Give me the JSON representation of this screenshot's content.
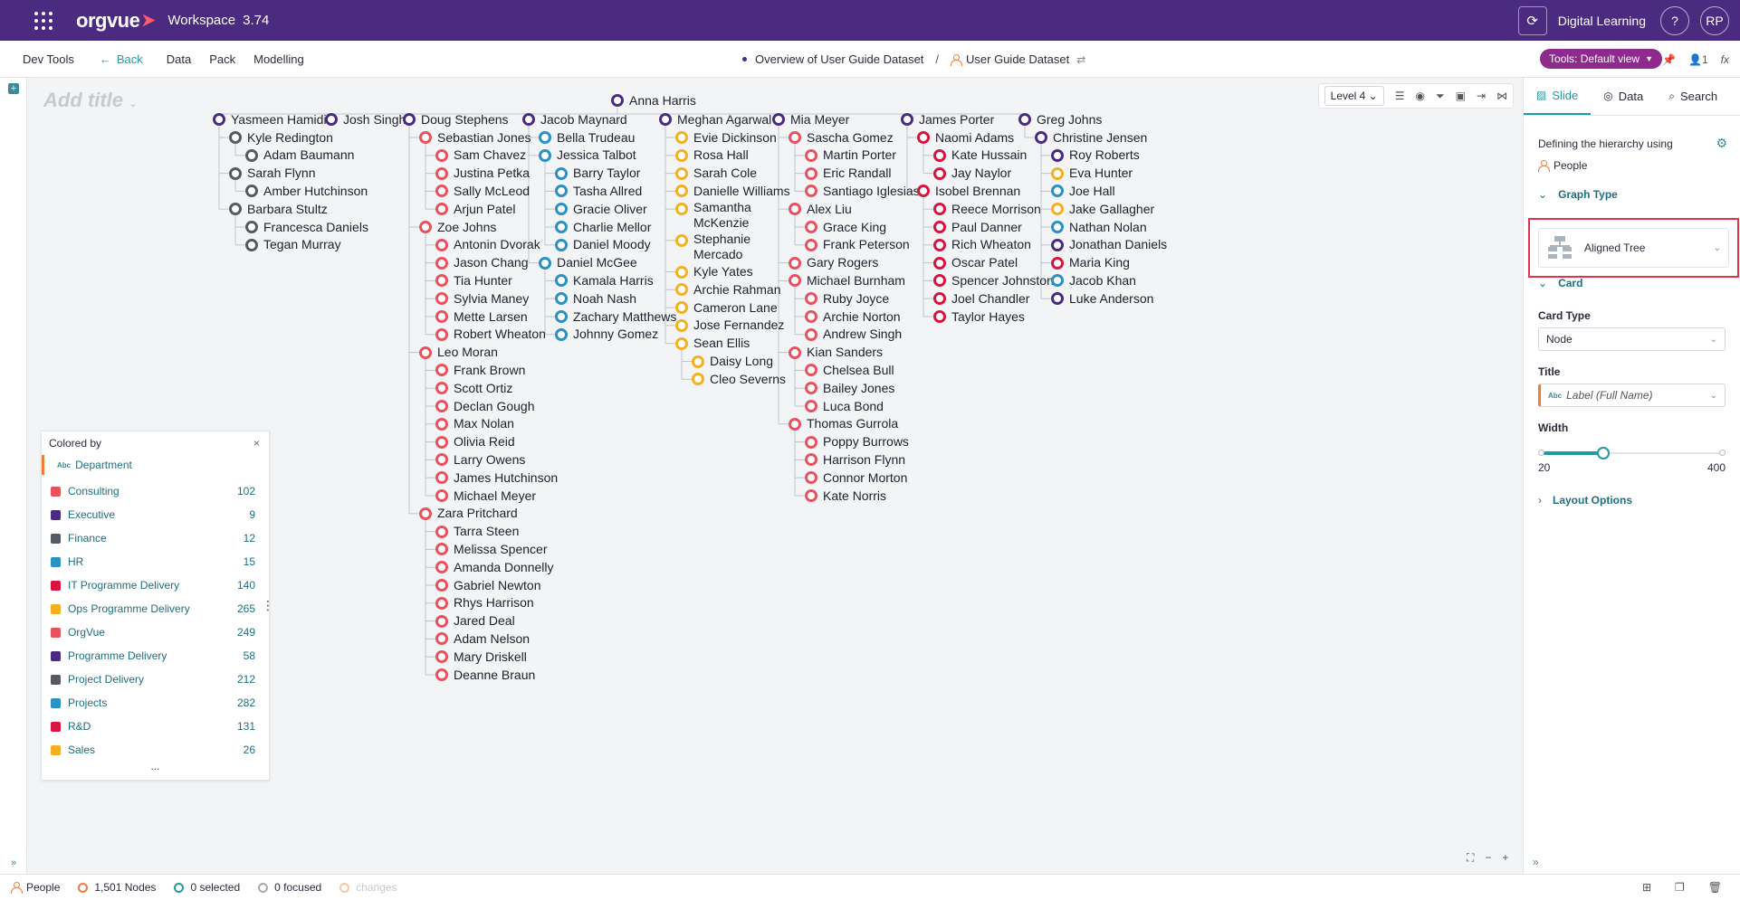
{
  "topbar": {
    "logo": "orgvue",
    "workspace": "Workspace",
    "version": "3.74",
    "digital_learning": "Digital Learning",
    "help": "?",
    "avatar": "RP"
  },
  "navbar": {
    "dev_tools": "Dev Tools",
    "back": "Back",
    "data": "Data",
    "pack": "Pack",
    "modelling": "Modelling",
    "breadcrumb_1": "Overview of User Guide Dataset",
    "breadcrumb_sep": "/",
    "breadcrumb_2": "User Guide Dataset",
    "tools": "Tools: Default view",
    "counter": "1"
  },
  "canvas": {
    "add_title": "Add title",
    "level": "Level 4"
  },
  "colors": {
    "Consulting": "#e8525e",
    "Executive": "#4a2b7f",
    "Finance": "#555a63",
    "HR": "#2b90c2",
    "IT Programme Delivery": "#d9143e",
    "Ops Programme Delivery": "#f5b021",
    "OrgVue": "#e8525e",
    "Programme Delivery": "#4a2b7f",
    "Project Delivery": "#555a63",
    "Projects": "#2b90c2",
    "R&D": "#d9143e",
    "Sales": "#f5b021"
  },
  "tree": {
    "root": "Anna Harris",
    "columns": [
      {
        "name": "Yasmeen Hamidi",
        "color": "#4a2b7f",
        "children": [
          {
            "name": "Kyle Redington",
            "color": "#555a63",
            "children": [
              {
                "name": "Adam Baumann",
                "color": "#555a63"
              }
            ]
          },
          {
            "name": "Sarah Flynn",
            "color": "#555a63",
            "children": [
              {
                "name": "Amber Hutchinson",
                "color": "#555a63"
              }
            ]
          },
          {
            "name": "Barbara Stultz",
            "color": "#555a63",
            "children": [
              {
                "name": "Francesca Daniels",
                "color": "#555a63"
              },
              {
                "name": "Tegan Murray",
                "color": "#555a63"
              }
            ]
          }
        ]
      },
      {
        "name": "Josh Singh",
        "color": "#4a2b7f",
        "children": []
      },
      {
        "name": "Doug Stephens",
        "color": "#4a2b7f",
        "children": [
          {
            "name": "Sebastian Jones",
            "color": "#e8525e",
            "children": [
              {
                "name": "Sam Chavez",
                "color": "#e8525e"
              },
              {
                "name": "Justina Petka",
                "color": "#e8525e"
              },
              {
                "name": "Sally McLeod",
                "color": "#e8525e"
              },
              {
                "name": "Arjun Patel",
                "color": "#e8525e"
              }
            ]
          },
          {
            "name": "Zoe Johns",
            "color": "#e8525e",
            "children": [
              {
                "name": "Antonin Dvorak",
                "color": "#e8525e"
              },
              {
                "name": "Jason Chang",
                "color": "#e8525e"
              },
              {
                "name": "Tia Hunter",
                "color": "#e8525e"
              },
              {
                "name": "Sylvia Maney",
                "color": "#e8525e"
              },
              {
                "name": "Mette Larsen",
                "color": "#e8525e"
              },
              {
                "name": "Robert Wheaton",
                "color": "#e8525e"
              }
            ]
          },
          {
            "name": "Leo Moran",
            "color": "#e8525e",
            "children": [
              {
                "name": "Frank Brown",
                "color": "#e8525e"
              },
              {
                "name": "Scott Ortiz",
                "color": "#e8525e"
              },
              {
                "name": "Declan Gough",
                "color": "#e8525e"
              },
              {
                "name": "Max Nolan",
                "color": "#e8525e"
              },
              {
                "name": "Olivia Reid",
                "color": "#e8525e"
              },
              {
                "name": "Larry Owens",
                "color": "#e8525e"
              },
              {
                "name": "James Hutchinson",
                "color": "#e8525e"
              },
              {
                "name": "Michael Meyer",
                "color": "#e8525e"
              }
            ]
          },
          {
            "name": "Zara Pritchard",
            "color": "#e8525e",
            "children": [
              {
                "name": "Tarra Steen",
                "color": "#e8525e"
              },
              {
                "name": "Melissa Spencer",
                "color": "#e8525e"
              },
              {
                "name": "Amanda Donnelly",
                "color": "#e8525e"
              },
              {
                "name": "Gabriel Newton",
                "color": "#e8525e"
              },
              {
                "name": "Rhys Harrison",
                "color": "#e8525e"
              },
              {
                "name": "Jared Deal",
                "color": "#e8525e"
              },
              {
                "name": "Adam Nelson",
                "color": "#e8525e"
              },
              {
                "name": "Mary Driskell",
                "color": "#e8525e"
              },
              {
                "name": "Deanne Braun",
                "color": "#e8525e"
              }
            ]
          }
        ]
      },
      {
        "name": "Jacob Maynard",
        "color": "#4a2b7f",
        "children": [
          {
            "name": "Bella Trudeau",
            "color": "#2b90c2",
            "children": []
          },
          {
            "name": "Jessica Talbot",
            "color": "#2b90c2",
            "children": [
              {
                "name": "Barry Taylor",
                "color": "#2b90c2"
              },
              {
                "name": "Tasha Allred",
                "color": "#2b90c2"
              },
              {
                "name": "Gracie Oliver",
                "color": "#2b90c2"
              },
              {
                "name": "Charlie Mellor",
                "color": "#2b90c2"
              },
              {
                "name": "Daniel Moody",
                "color": "#2b90c2"
              }
            ]
          },
          {
            "name": "Daniel McGee",
            "color": "#2b90c2",
            "children": [
              {
                "name": "Kamala Harris",
                "color": "#2b90c2"
              },
              {
                "name": "Noah Nash",
                "color": "#2b90c2"
              },
              {
                "name": "Zachary Matthews",
                "color": "#2b90c2"
              },
              {
                "name": "Johnny Gomez",
                "color": "#2b90c2"
              }
            ]
          }
        ]
      },
      {
        "name": "Meghan Agarwal",
        "color": "#4a2b7f",
        "children": [
          {
            "name": "Evie Dickinson",
            "color": "#f5b021",
            "children": []
          },
          {
            "name": "Rosa Hall",
            "color": "#f5b021",
            "children": []
          },
          {
            "name": "Sarah Cole",
            "color": "#f5b021",
            "children": []
          },
          {
            "name": "Danielle Williams",
            "color": "#f5b021",
            "children": []
          },
          {
            "name": "Samantha McKenzie",
            "color": "#f5b021",
            "children": []
          },
          {
            "name": "Stephanie Mercado",
            "color": "#f5b021",
            "children": []
          },
          {
            "name": "Kyle Yates",
            "color": "#f5b021",
            "children": []
          },
          {
            "name": "Archie Rahman",
            "color": "#f5b021",
            "children": []
          },
          {
            "name": "Cameron Lane",
            "color": "#f5b021",
            "children": []
          },
          {
            "name": "Jose Fernandez",
            "color": "#f5b021",
            "children": []
          },
          {
            "name": "Sean Ellis",
            "color": "#f5b021",
            "children": [
              {
                "name": "Daisy Long",
                "color": "#f5b021"
              },
              {
                "name": "Cleo Severns",
                "color": "#f5b021"
              }
            ]
          }
        ]
      },
      {
        "name": "Mia Meyer",
        "color": "#4a2b7f",
        "children": [
          {
            "name": "Sascha Gomez",
            "color": "#e8525e",
            "children": [
              {
                "name": "Martin Porter",
                "color": "#e8525e"
              },
              {
                "name": "Eric Randall",
                "color": "#e8525e"
              },
              {
                "name": "Santiago Iglesias",
                "color": "#e8525e"
              }
            ]
          },
          {
            "name": "Alex Liu",
            "color": "#e8525e",
            "children": [
              {
                "name": "Grace King",
                "color": "#e8525e"
              },
              {
                "name": "Frank Peterson",
                "color": "#e8525e"
              }
            ]
          },
          {
            "name": "Gary Rogers",
            "color": "#e8525e",
            "children": []
          },
          {
            "name": "Michael Burnham",
            "color": "#e8525e",
            "children": [
              {
                "name": "Ruby Joyce",
                "color": "#e8525e"
              },
              {
                "name": "Archie Norton",
                "color": "#e8525e"
              },
              {
                "name": "Andrew Singh",
                "color": "#e8525e"
              }
            ]
          },
          {
            "name": "Kian Sanders",
            "color": "#e8525e",
            "children": [
              {
                "name": "Chelsea Bull",
                "color": "#e8525e"
              },
              {
                "name": "Bailey Jones",
                "color": "#e8525e"
              },
              {
                "name": "Luca Bond",
                "color": "#e8525e"
              }
            ]
          },
          {
            "name": "Thomas Gurrola",
            "color": "#e8525e",
            "children": [
              {
                "name": "Poppy Burrows",
                "color": "#e8525e"
              },
              {
                "name": "Harrison Flynn",
                "color": "#e8525e"
              },
              {
                "name": "Connor Morton",
                "color": "#e8525e"
              },
              {
                "name": "Kate Norris",
                "color": "#e8525e"
              }
            ]
          }
        ]
      },
      {
        "name": "James Porter",
        "color": "#4a2b7f",
        "children": [
          {
            "name": "Naomi Adams",
            "color": "#d9143e",
            "children": [
              {
                "name": "Kate Hussain",
                "color": "#d9143e"
              },
              {
                "name": "Jay Naylor",
                "color": "#d9143e"
              }
            ]
          },
          {
            "name": "Isobel Brennan",
            "color": "#d9143e",
            "children": [
              {
                "name": "Reece Morrison",
                "color": "#d9143e"
              },
              {
                "name": "Paul Danner",
                "color": "#d9143e"
              },
              {
                "name": "Rich Wheaton",
                "color": "#d9143e"
              },
              {
                "name": "Oscar Patel",
                "color": "#d9143e"
              },
              {
                "name": "Spencer Johnston",
                "color": "#d9143e"
              },
              {
                "name": "Joel Chandler",
                "color": "#d9143e"
              },
              {
                "name": "Taylor Hayes",
                "color": "#d9143e"
              }
            ]
          }
        ]
      },
      {
        "name": "Greg Johns",
        "color": "#4a2b7f",
        "children": [
          {
            "name": "Christine Jensen",
            "color": "#4a2b7f",
            "children": [
              {
                "name": "Roy Roberts",
                "color": "#4a2b7f"
              },
              {
                "name": "Eva Hunter",
                "color": "#f5b021"
              },
              {
                "name": "Joe Hall",
                "color": "#2b90c2"
              },
              {
                "name": "Jake Gallagher",
                "color": "#f5b021"
              },
              {
                "name": "Nathan Nolan",
                "color": "#2b90c2"
              },
              {
                "name": "Jonathan Daniels",
                "color": "#4a2b7f"
              },
              {
                "name": "Maria King",
                "color": "#d9143e"
              },
              {
                "name": "Jacob Khan",
                "color": "#2b90c2"
              },
              {
                "name": "Luke Anderson",
                "color": "#4a2b7f"
              }
            ]
          }
        ]
      }
    ]
  },
  "legend": {
    "header": "Colored by",
    "close": "×",
    "field": "Department",
    "more": "...",
    "items": [
      {
        "name": "Consulting",
        "count": "102",
        "color": "#e8525e"
      },
      {
        "name": "Executive",
        "count": "9",
        "color": "#4a2b7f"
      },
      {
        "name": "Finance",
        "count": "12",
        "color": "#555a63"
      },
      {
        "name": "HR",
        "count": "15",
        "color": "#2b90c2"
      },
      {
        "name": "IT Programme Delivery",
        "count": "140",
        "color": "#d9143e"
      },
      {
        "name": "Ops Programme Delivery",
        "count": "265",
        "color": "#f5b021"
      },
      {
        "name": "OrgVue",
        "count": "249",
        "color": "#e8525e"
      },
      {
        "name": "Programme Delivery",
        "count": "58",
        "color": "#4a2b7f"
      },
      {
        "name": "Project Delivery",
        "count": "212",
        "color": "#555a63"
      },
      {
        "name": "Projects",
        "count": "282",
        "color": "#2b90c2"
      },
      {
        "name": "R&D",
        "count": "131",
        "color": "#d9143e"
      },
      {
        "name": "Sales",
        "count": "26",
        "color": "#f5b021"
      }
    ]
  },
  "panel": {
    "tab_slide": "Slide",
    "tab_data": "Data",
    "tab_search": "Search",
    "defining": "Defining the hierarchy using",
    "people": "People",
    "graph_type_label": "Graph Type",
    "graph_type_value": "Aligned Tree",
    "card_label": "Card",
    "card_type_label": "Card Type",
    "card_type_value": "Node",
    "title_label": "Title",
    "title_value": "Label (Full Name)",
    "width_label": "Width",
    "width_min": "20",
    "width_max": "400",
    "width_fraction": 0.2,
    "layout_options": "Layout Options"
  },
  "status": {
    "people": "People",
    "nodes": "1,501 Nodes",
    "selected": "0 selected",
    "focused": "0 focused",
    "changes": "changes"
  }
}
